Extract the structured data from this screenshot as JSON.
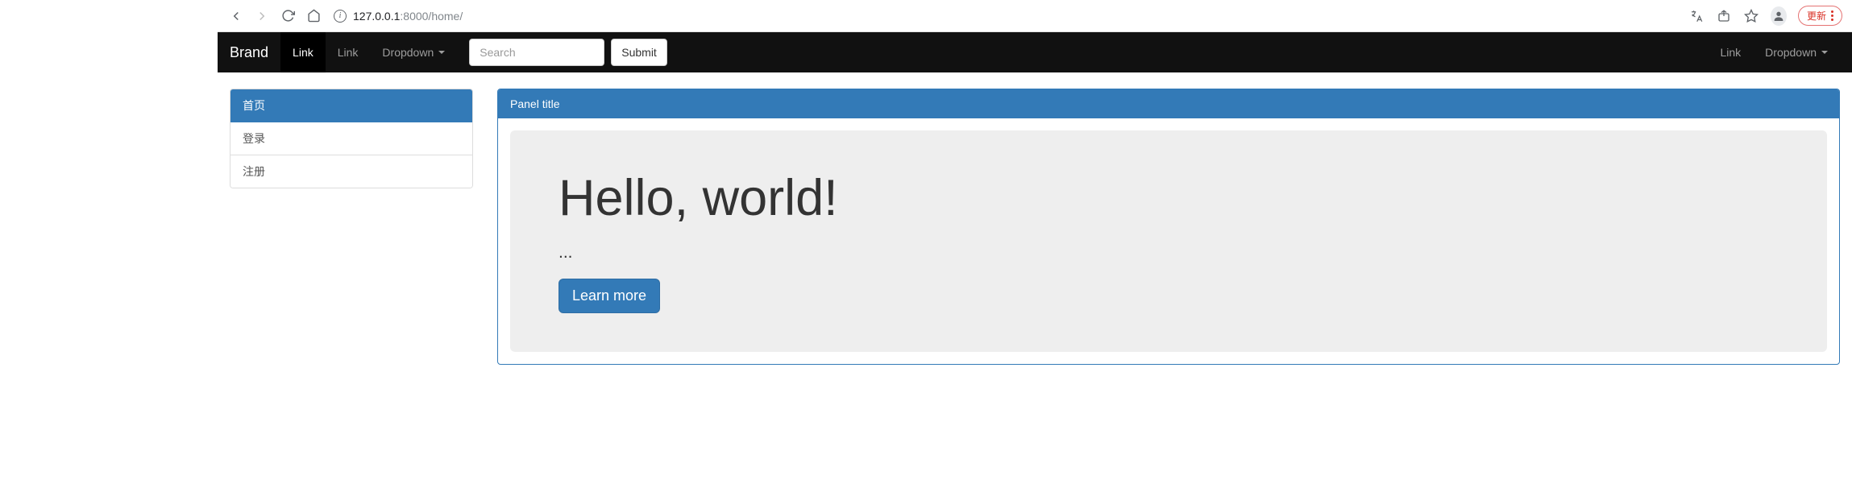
{
  "browser": {
    "url_host": "127.0.0.1",
    "url_port_path": ":8000/home/",
    "update_label": "更新"
  },
  "navbar": {
    "brand": "Brand",
    "link_active": "Link",
    "link_2": "Link",
    "dropdown": "Dropdown",
    "search_placeholder": "Search",
    "submit_label": "Submit",
    "right_link": "Link",
    "right_dropdown": "Dropdown"
  },
  "sidebar": {
    "items": [
      {
        "label": "首页",
        "active": true
      },
      {
        "label": "登录",
        "active": false
      },
      {
        "label": "注册",
        "active": false
      }
    ]
  },
  "panel": {
    "title": "Panel title"
  },
  "jumbotron": {
    "heading": "Hello, world!",
    "text": "...",
    "button": "Learn more"
  }
}
